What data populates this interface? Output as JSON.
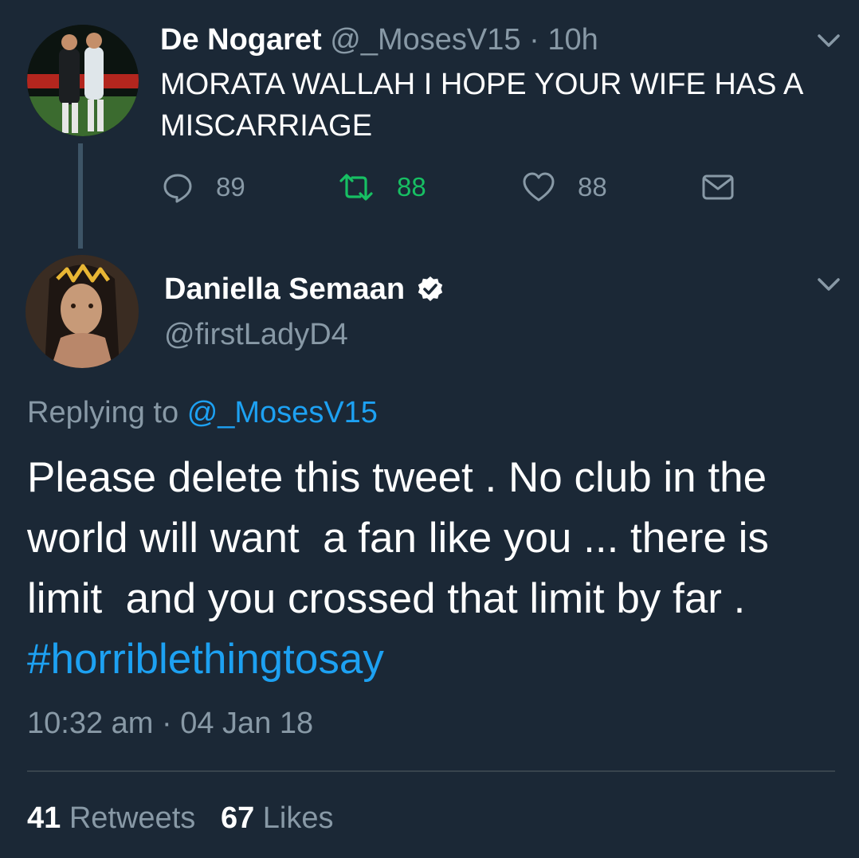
{
  "parent_tweet": {
    "author_name": "De Nogaret",
    "author_handle": "@_MosesV15",
    "separator": "·",
    "time_ago": "10h",
    "text": "MORATA WALLAH I HOPE YOUR WIFE HAS A MISCARRIAGE",
    "actions": {
      "reply_count": "89",
      "retweet_count": "88",
      "like_count": "88"
    },
    "icons": {
      "reply": "reply-icon",
      "retweet": "retweet-icon",
      "like": "heart-icon",
      "dm": "mail-icon",
      "menu": "chevron-down-icon"
    }
  },
  "main_tweet": {
    "author_name": "Daniella Semaan",
    "author_handle": "@firstLadyD4",
    "verified_icon": "verified-badge-icon",
    "replying_label": "Replying to",
    "replying_to": "@_MosesV15",
    "text_body": "Please delete this tweet . No club in the world will want  a fan like you ... there is limit  and you crossed that limit by far . ",
    "hashtag": "#horriblethingtosay",
    "time": "10:32 am",
    "separator": "·",
    "date": "04 Jan 18",
    "retweets_count": "41",
    "retweets_label": "Retweets",
    "likes_count": "67",
    "likes_label": "Likes"
  },
  "colors": {
    "background": "#1b2836",
    "muted_text": "#8899a6",
    "link": "#1da1f2",
    "retweet_green": "#17bf63",
    "divider": "#38444d"
  }
}
